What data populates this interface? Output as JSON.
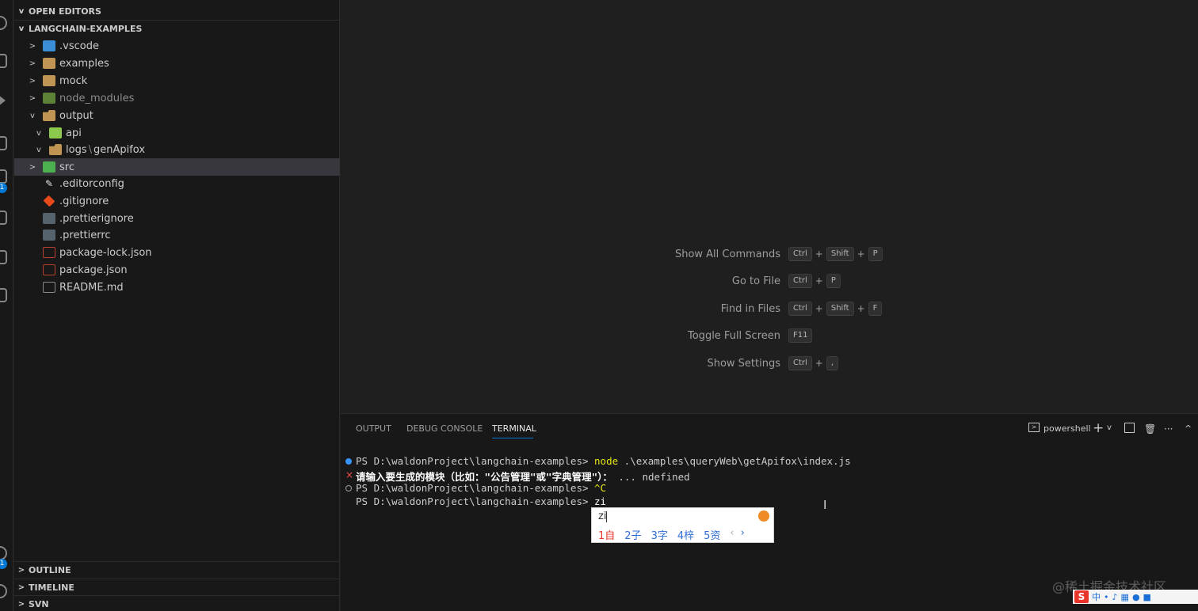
{
  "activity_bar": {
    "badges": [
      "1",
      "1"
    ]
  },
  "explorer": {
    "open_editors": "OPEN EDITORS",
    "workspace": "LANGCHAIN-EXAMPLES",
    "tree": [
      {
        "label": ".vscode",
        "chev": ">",
        "icon": "vscode-folder-icon"
      },
      {
        "label": "examples",
        "chev": ">",
        "icon": "folder-icon"
      },
      {
        "label": "mock",
        "chev": ">",
        "icon": "folder-icon"
      },
      {
        "label": "node_modules",
        "chev": ">",
        "icon": "node-folder-icon"
      },
      {
        "label": "output",
        "chev": "v",
        "icon": "folder-open-icon"
      },
      {
        "label": "api",
        "chev": "v",
        "icon": "api-folder-icon"
      },
      {
        "label_a": "logs",
        "sep": "\\",
        "label_b": "genApifox",
        "chev": "v",
        "icon": "folder-open-icon"
      },
      {
        "label": "src",
        "chev": ">",
        "icon": "src-folder-icon"
      },
      {
        "label": ".editorconfig",
        "icon": "editorconfig-icon"
      },
      {
        "label": ".gitignore",
        "icon": "git-icon"
      },
      {
        "label": ".prettierignore",
        "icon": "prettier-icon"
      },
      {
        "label": ".prettierrc",
        "icon": "prettier-icon"
      },
      {
        "label": "package-lock.json",
        "icon": "json-icon"
      },
      {
        "label": "package.json",
        "icon": "json-icon"
      },
      {
        "label": "README.md",
        "icon": "markdown-icon"
      }
    ],
    "outline": "OUTLINE",
    "timeline": "TIMELINE",
    "svn": "SVN"
  },
  "editor": {
    "shortcuts": [
      {
        "label": "Show All Commands",
        "keys": [
          "Ctrl",
          "Shift",
          "P"
        ]
      },
      {
        "label": "Go to File",
        "keys": [
          "Ctrl",
          "P"
        ]
      },
      {
        "label": "Find in Files",
        "keys": [
          "Ctrl",
          "Shift",
          "F"
        ]
      },
      {
        "label": "Toggle Full Screen",
        "keys": [
          "F11"
        ]
      },
      {
        "label": "Show Settings",
        "keys": [
          "Ctrl",
          ","
        ]
      }
    ]
  },
  "panel": {
    "tabs": [
      "OUTPUT",
      "DEBUG CONSOLE",
      "TERMINAL"
    ],
    "active_tab": "TERMINAL",
    "shell": "powershell",
    "terminal": {
      "line1_prompt": "PS D:\\waldonProject\\langchain-examples> ",
      "line1_cmd": "node",
      "line1_args": " .\\examples\\queryWeb\\getApifox\\index.js",
      "line2_error": "请输入要生成的模块（比如：\"公告管理\"或\"字典管理\"）：",
      "line2_rest": " ... ndefined",
      "line3_prompt": "PS D:\\waldonProject\\langchain-examples> ",
      "line3_cmd": "^C",
      "line4_prompt": "PS D:\\waldonProject\\langchain-examples> ",
      "line4_cmd": "zi"
    }
  },
  "ime": {
    "input": "zi",
    "candidates": [
      "1自",
      "2子",
      "3字",
      "4梓",
      "5资"
    ],
    "prev": "‹",
    "next": "›"
  },
  "overlay": {
    "watermark": "@稀土掘金技术社区",
    "tray_logo": "S",
    "tray_lang": "中"
  }
}
